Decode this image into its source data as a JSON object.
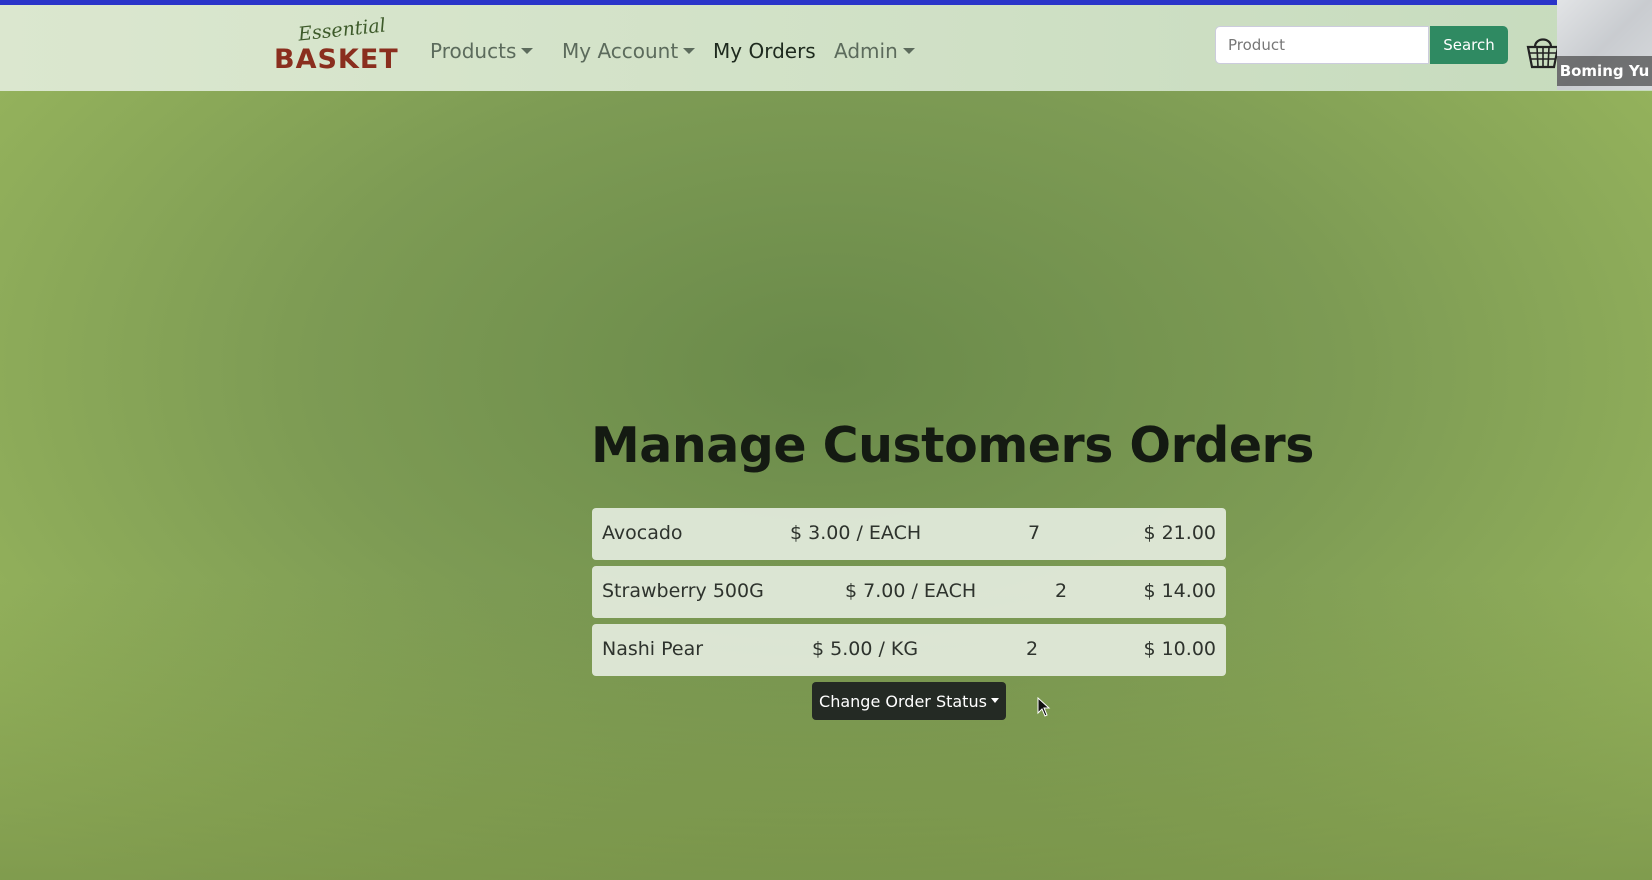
{
  "brand": {
    "script": "Essential",
    "name": "BASKET"
  },
  "nav": {
    "products": "Products",
    "my_account": "My Account",
    "my_orders": "My Orders",
    "admin": "Admin"
  },
  "search": {
    "placeholder": "Product",
    "button": "Search"
  },
  "webcam": {
    "name": "Boming Yu"
  },
  "main": {
    "title": "Manage Customers Orders",
    "items": [
      {
        "name": "Avocado",
        "price": "$ 3.00 / EACH",
        "qty": "7",
        "total": "$ 21.00"
      },
      {
        "name": "Strawberry 500G",
        "price": "$ 7.00 / EACH",
        "qty": "2",
        "total": "$ 14.00"
      },
      {
        "name": "Nashi Pear",
        "price": "$ 5.00 / KG",
        "qty": "2",
        "total": "$ 10.00"
      }
    ],
    "status_button": "Change Order Status"
  },
  "colors": {
    "accent_top": "#2a35c9",
    "search_button": "#2f8a62",
    "brand_red": "#8a2e1e",
    "background": "#7d9b54"
  }
}
